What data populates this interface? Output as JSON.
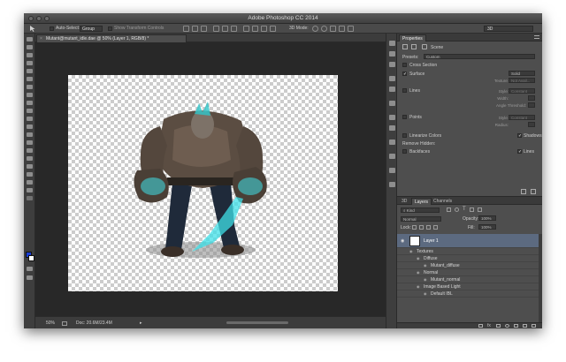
{
  "app": {
    "title": "Adobe Photoshop CC 2014"
  },
  "options_bar": {
    "auto_select_label": "Auto-Select:",
    "auto_select_value": "Group",
    "show_transform_label": "Show Transform Controls",
    "mode_3d_label": "3D Mode:",
    "workspace_value": "3D"
  },
  "document": {
    "tab_label": "Mutant@mutant_idle.dae @ 50% (Layer 1, RGB/8) *",
    "close_glyph": "×"
  },
  "status": {
    "zoom": "50%",
    "doc_size": "Doc: 20.6M/23.4M",
    "arrow": "▸"
  },
  "properties": {
    "tab_label": "Properties",
    "scene_label": "Scene",
    "presets_label": "Presets:",
    "presets_value": "Custom",
    "cross_section_label": "Cross Section",
    "surface_label": "Surface",
    "style_label": "Style:",
    "style_value": "Solid",
    "texture_label": "Texture:",
    "texture_value": "Not Avail...",
    "lines_label": "Lines",
    "lines_style_label": "Style:",
    "lines_style_value": "Constant",
    "width_label": "Width:",
    "angle_threshold_label": "Angle Threshold:",
    "points_label": "Points",
    "points_style_label": "Style:",
    "points_style_value": "Constant",
    "radius_label": "Radius:",
    "linearize_colors_label": "Linearize Colors",
    "shadows_label": "Shadows",
    "remove_hidden_label": "Remove Hidden:",
    "backfaces_label": "Backfaces",
    "lines_check_label": "Lines"
  },
  "layers": {
    "tabs": [
      "3D",
      "Layers",
      "Channels"
    ],
    "active_tab": "Layers",
    "kind_label": "Kind",
    "blend_mode": "Normal",
    "opacity_label": "Opacity:",
    "opacity_value": "100%",
    "lock_label": "Lock:",
    "fill_label": "Fill:",
    "fill_value": "100%",
    "items": [
      {
        "name": "Layer 1",
        "indent": 0,
        "selected": true
      },
      {
        "name": "Textures",
        "indent": 1,
        "selected": false
      },
      {
        "name": "Diffuse",
        "indent": 2,
        "selected": false
      },
      {
        "name": "Mutant_diffuse",
        "indent": 3,
        "selected": false
      },
      {
        "name": "Normal",
        "indent": 2,
        "selected": false
      },
      {
        "name": "Mutant_normal",
        "indent": 3,
        "selected": false
      },
      {
        "name": "Image Based Light",
        "indent": 2,
        "selected": false
      },
      {
        "name": "Default IBL",
        "indent": 3,
        "selected": false
      }
    ]
  },
  "colors": {
    "chrome": "#535353",
    "panel": "#4e4e4e",
    "workspace": "#282828",
    "selected_layer": "#5c6a80",
    "foreground_color": "#1a3fd6",
    "background_color": "#ffffff",
    "glow": "#3fe0e8"
  },
  "icons": {
    "tools": [
      "move-tool-icon",
      "marquee-tool-icon",
      "lasso-tool-icon",
      "quick-select-tool-icon",
      "crop-tool-icon",
      "eyedropper-tool-icon",
      "healing-brush-tool-icon",
      "brush-tool-icon",
      "clone-stamp-tool-icon",
      "history-brush-tool-icon",
      "eraser-tool-icon",
      "gradient-tool-icon",
      "blur-tool-icon",
      "dodge-tool-icon",
      "pen-tool-icon",
      "type-tool-icon",
      "path-select-tool-icon",
      "rectangle-tool-icon",
      "hand-tool-icon",
      "zoom-tool-icon"
    ],
    "dock": [
      "history-icon",
      "brush-presets-icon",
      "adjustments-icon",
      "styles-icon",
      "character-icon",
      "paragraph-icon",
      "3d-icon",
      "tool-presets-icon"
    ]
  }
}
